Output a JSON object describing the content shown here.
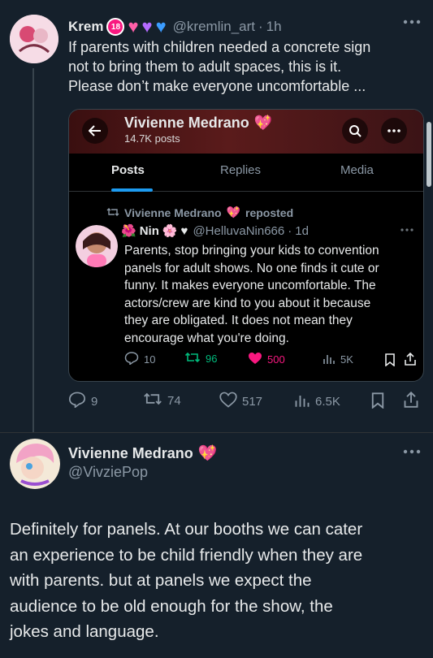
{
  "top_tweet": {
    "name": "Krem",
    "handle": "@kremlin_art",
    "time": "1h",
    "badge": "18",
    "hearts": [
      "♥",
      "♥",
      "♥"
    ],
    "text_lines": [
      "If parents with children needed a concrete sign",
      "not to bring them to adult spaces, this is it.",
      "Please don’t make everyone uncomfortable ..."
    ],
    "stats": {
      "replies": "9",
      "reposts": "74",
      "likes": "517",
      "views": "6.5K"
    }
  },
  "embed": {
    "profile_name": "Vivienne Medrano",
    "posts_count": "14.7K posts",
    "tabs": [
      "Posts",
      "Replies",
      "Media"
    ],
    "repost_label": "Vivienne Medrano",
    "repost_suffix": "reposted",
    "inner_name": "Nin",
    "inner_handle": "@HelluvaNin666",
    "inner_time": "1d",
    "inner_text_lines": [
      "Parents, stop bringing your kids to convention",
      "panels for adult shows. No one finds it cute or",
      "funny. It makes everyone uncomfortable. The",
      "actors/crew are kind to you about it because",
      "they are obligated. It does not mean they",
      "encourage what you're doing."
    ],
    "inner_stats": {
      "replies": "10",
      "reposts": "96",
      "likes": "500",
      "views": "5K"
    }
  },
  "reply": {
    "name": "Vivienne Medrano",
    "handle": "@VivziePop",
    "text_lines": [
      "Definitely for panels. At our booths we can cater",
      "an experience to be child friendly when they are",
      "with parents. but at panels we expect the",
      "audience to be old enough for the show, the",
      "jokes and language."
    ]
  },
  "colors": {
    "background": "#15202b",
    "accent_blue": "#1d9bf0",
    "like_pink": "#f91880",
    "repost_green": "#00ba7c",
    "muted": "#8b98a5"
  },
  "icons": [
    "more-icon",
    "back-arrow-icon",
    "search-icon",
    "reply-icon",
    "repost-icon",
    "like-icon",
    "views-icon",
    "bookmark-icon",
    "share-icon",
    "verified-heart-icon"
  ]
}
